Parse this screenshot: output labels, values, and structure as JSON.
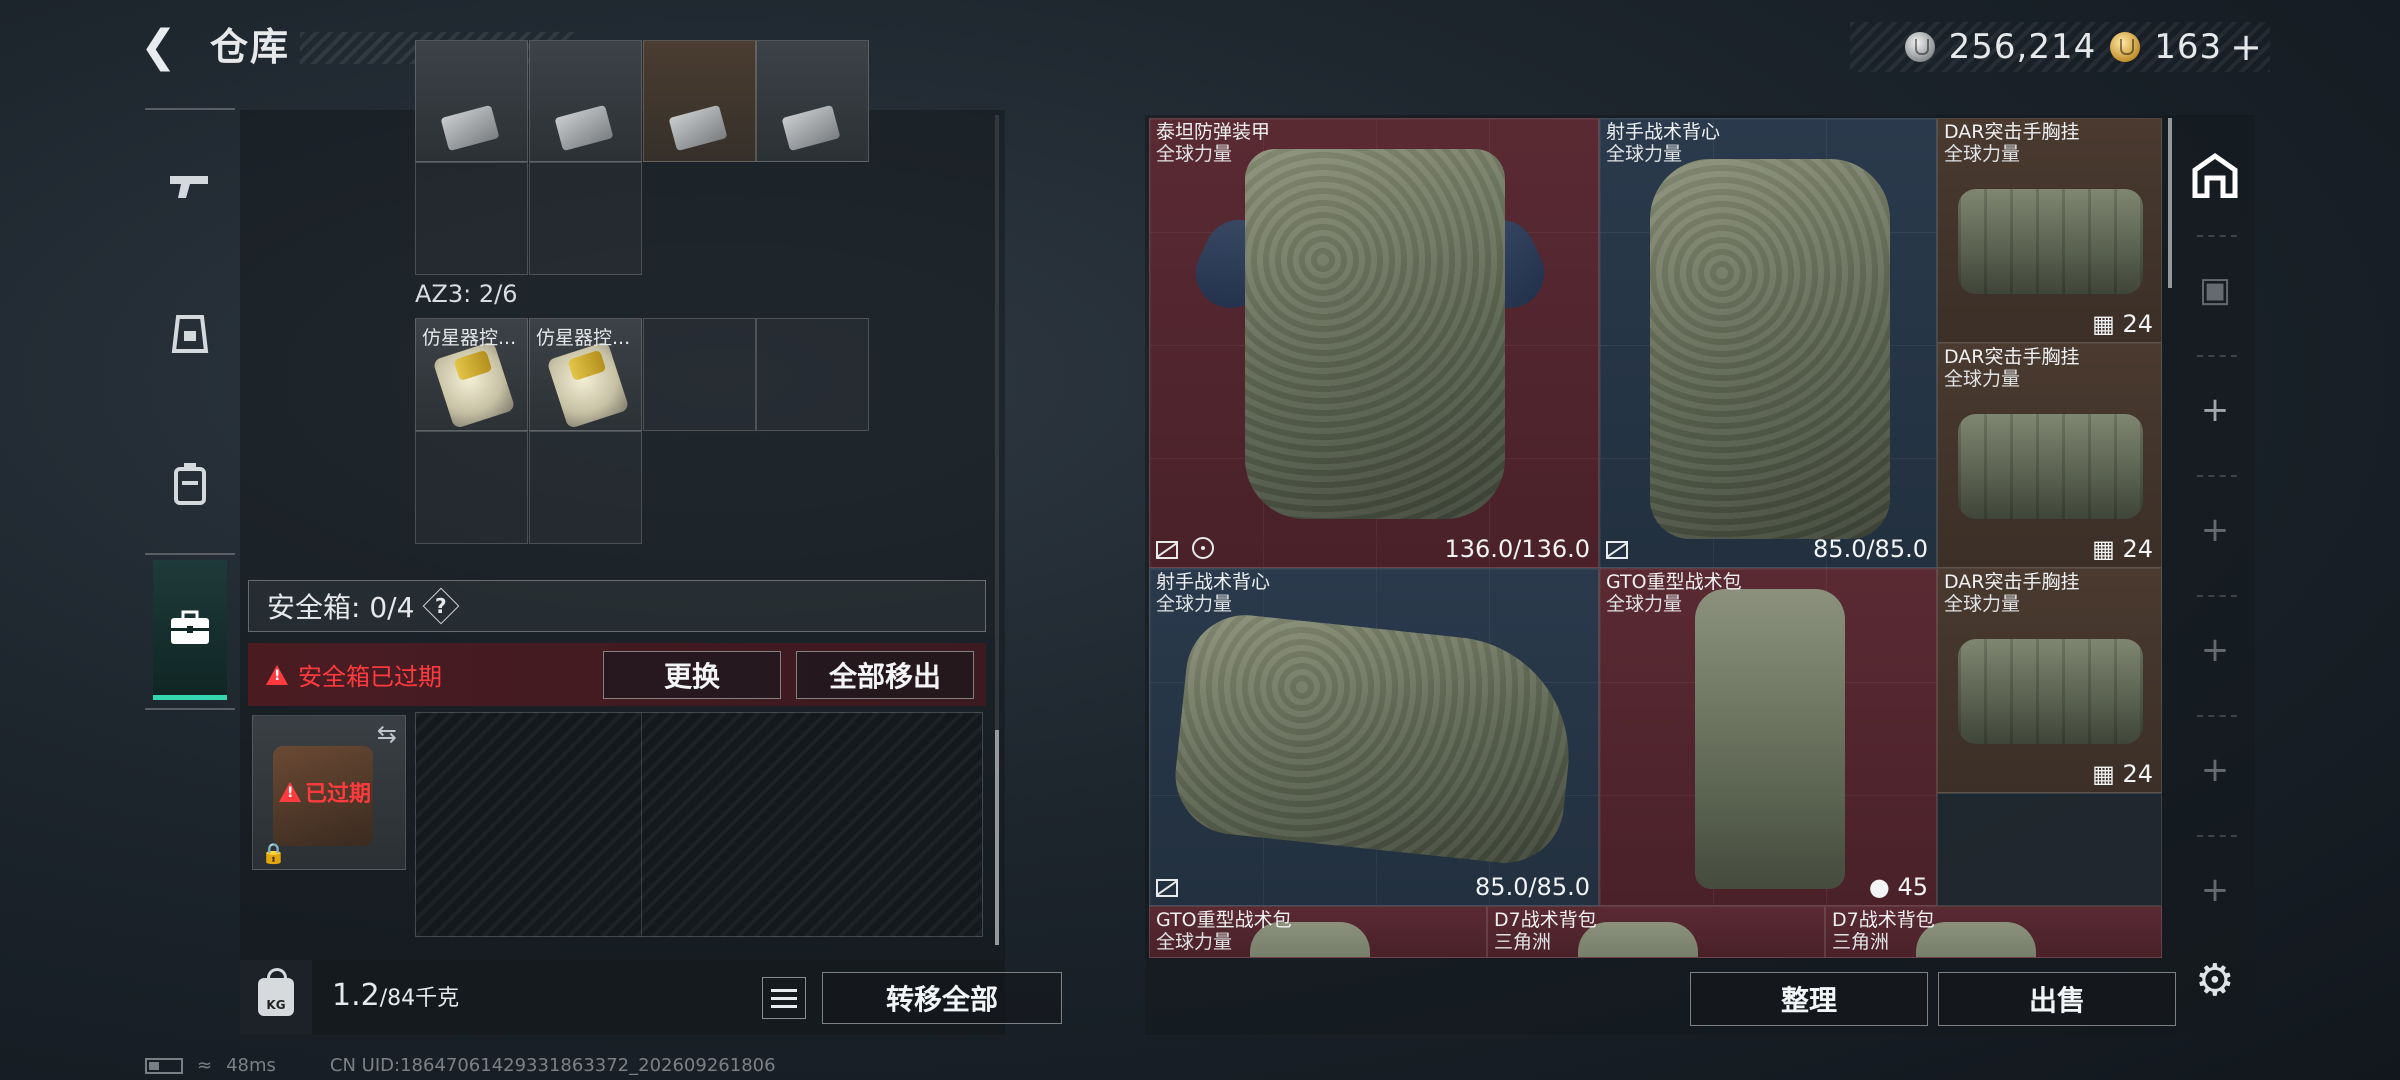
{
  "header": {
    "back_icon": "chevron-left-icon",
    "title": "仓库",
    "currency": [
      {
        "icon": "silver-coin-icon",
        "value": "256,214"
      },
      {
        "icon": "gold-coin-icon",
        "value": "163"
      }
    ],
    "add_label": "+"
  },
  "sidebar": {
    "tabs": [
      {
        "icon": "gun-icon",
        "active": false
      },
      {
        "icon": "helmet-icon",
        "active": false
      },
      {
        "icon": "backpack-icon",
        "active": false
      },
      {
        "icon": "case-icon",
        "active": true
      }
    ]
  },
  "left": {
    "container_label": "AZ3: 2/6",
    "container_items": [
      "仿星器控...",
      "仿星器控..."
    ],
    "safe_box": {
      "label": "安全箱: 0/4",
      "help": "?",
      "warning": "安全箱已过期",
      "replace_label": "更换",
      "move_all_label": "全部移出",
      "case_status": "已过期"
    },
    "weight": {
      "current": "1.2",
      "max": "/84千克",
      "lock_text": "KG"
    },
    "transfer_all_label": "转移全部"
  },
  "status": {
    "ping": "48ms",
    "uid": "CN UID:18647061429331863372_202609261806"
  },
  "storage": {
    "items": [
      {
        "name": "泰坦防弹装甲",
        "sub": "全球力量",
        "value": "136.0/136.0"
      },
      {
        "name": "射手战术背心",
        "sub": "全球力量",
        "value": "85.0/85.0"
      },
      {
        "name": "DAR突击手胸挂",
        "sub": "全球力量",
        "value": "24"
      },
      {
        "name": "DAR突击手胸挂",
        "sub": "全球力量",
        "value": "24"
      },
      {
        "name": "射手战术背心",
        "sub": "全球力量",
        "value": "85.0/85.0"
      },
      {
        "name": "GTO重型战术包",
        "sub": "全球力量",
        "value": "45"
      },
      {
        "name": "DAR突击手胸挂",
        "sub": "全球力量",
        "value": "24"
      },
      {
        "name": "GTO重型战术包",
        "sub": "全球力量",
        "value": ""
      },
      {
        "name": "D7战术背包",
        "sub": "三角洲",
        "value": ""
      },
      {
        "name": "D7战术背包",
        "sub": "三角洲",
        "value": ""
      }
    ],
    "sort_label": "整理",
    "sell_label": "出售"
  },
  "colors": {
    "accent": "#37d6b2",
    "warning": "#ff3b3f",
    "card_red": "#5a2a33",
    "card_blue": "#2a3a4c",
    "card_brown": "#4a3a30"
  }
}
